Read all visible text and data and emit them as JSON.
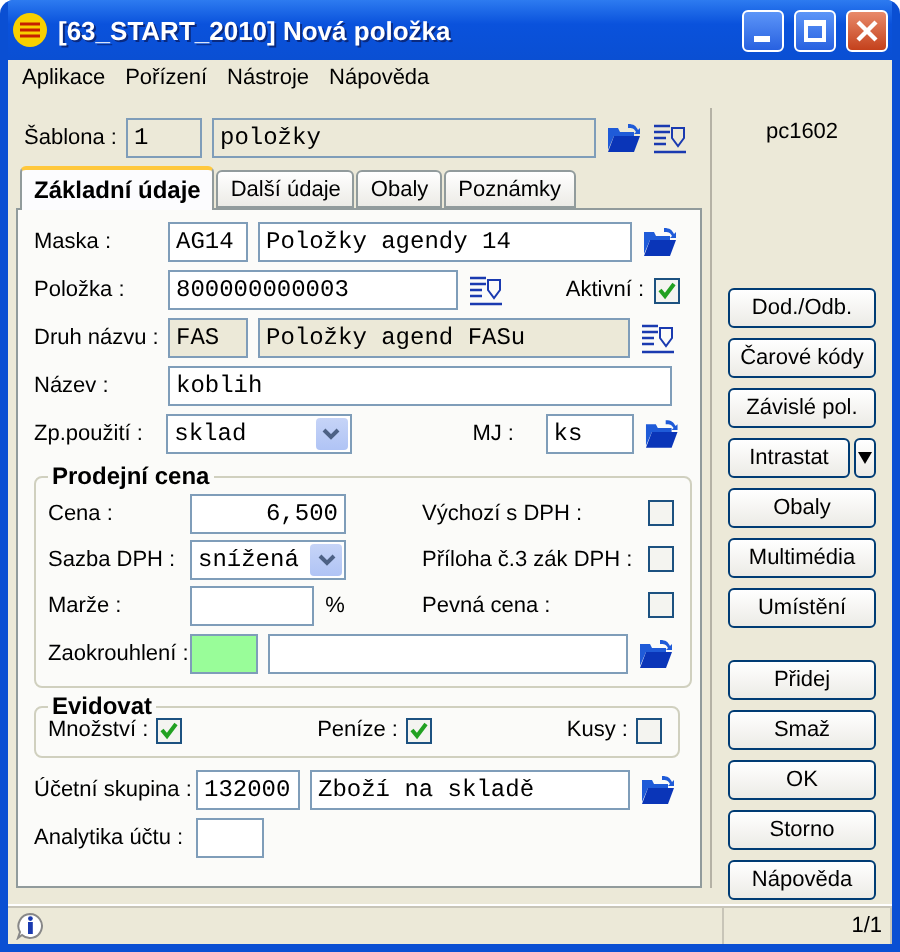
{
  "window": {
    "title": "[63_START_2010] Nová položka"
  },
  "menu": [
    {
      "label": "Aplikace"
    },
    {
      "label": "Pořízení"
    },
    {
      "label": "Nástroje"
    },
    {
      "label": "Nápověda"
    }
  ],
  "template": {
    "label": "Šablona :",
    "code": "1",
    "name": "položky",
    "disabled": true
  },
  "tabs": [
    {
      "label": "Základní údaje",
      "selected": true
    },
    {
      "label": "Další údaje",
      "selected": false
    },
    {
      "label": "Obaly",
      "selected": false
    },
    {
      "label": "Poznámky",
      "selected": false
    }
  ],
  "fields": {
    "maska": {
      "label": "Maska :",
      "code": "AG14",
      "name": "Položky agendy 14"
    },
    "polozka": {
      "label": "Položka :",
      "value": "800000000003"
    },
    "aktivni": {
      "label": "Aktivní :",
      "checked": true
    },
    "druh": {
      "label": "Druh názvu :",
      "code": "FAS",
      "name": "Položky agend FASu",
      "disabled": true
    },
    "nazev": {
      "label": "Název :",
      "value": "koblih"
    },
    "pouziti": {
      "label": "Zp.použití :",
      "value": "sklad"
    },
    "mj": {
      "label": "MJ :",
      "value": "ks"
    }
  },
  "price": {
    "title": "Prodejní cena",
    "cena": {
      "label": "Cena :",
      "value": "6,500"
    },
    "sazba": {
      "label": "Sazba DPH :",
      "value": "snížená"
    },
    "marze": {
      "label": "Marže :",
      "unit": "%"
    },
    "zaokrouhleni": {
      "label": "Zaokrouhlení :"
    },
    "options": [
      {
        "label": "Výchozí s DPH :",
        "checked": false
      },
      {
        "label": "Příloha č.3 zák DPH :",
        "checked": false
      },
      {
        "label": "Pevná cena :",
        "checked": false
      }
    ]
  },
  "evidovat": {
    "title": "Evidovat",
    "items": [
      {
        "label": "Množství :",
        "checked": true
      },
      {
        "label": "Peníze :",
        "checked": true
      },
      {
        "label": "Kusy :",
        "checked": false
      }
    ]
  },
  "account": {
    "label": "Účetní skupina :",
    "code": "132000",
    "name": "Zboží na skladě"
  },
  "analytics": {
    "label": "Analytika účtu :"
  },
  "sidebar": {
    "user": "pc1602",
    "buttons": [
      {
        "label": "Dod./Odb.",
        "kind": "button"
      },
      {
        "label": "Čarové kódy",
        "kind": "button"
      },
      {
        "label": "Závislé pol.",
        "kind": "button"
      },
      {
        "label": "Intrastat",
        "kind": "split"
      },
      {
        "label": "Obaly",
        "kind": "button"
      },
      {
        "label": "Multimédia",
        "kind": "button"
      },
      {
        "label": "Umístění",
        "kind": "button"
      }
    ],
    "actions": [
      {
        "label": "Přidej"
      },
      {
        "label": "Smaž"
      },
      {
        "label": "OK"
      },
      {
        "label": "Storno"
      },
      {
        "label": "Nápověda"
      }
    ]
  },
  "status": {
    "page": "1/1"
  }
}
